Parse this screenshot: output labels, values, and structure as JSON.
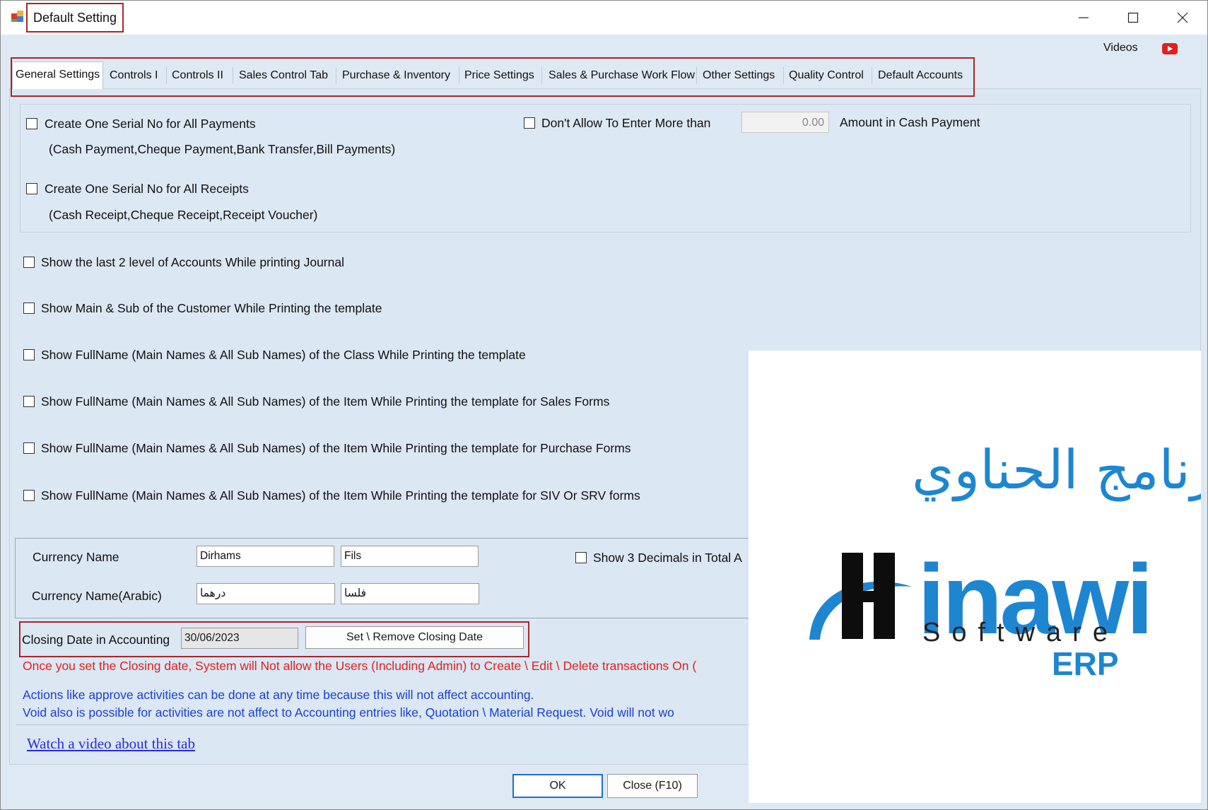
{
  "window": {
    "title": "Default Setting"
  },
  "header": {
    "videos_label": "Videos"
  },
  "tabs": [
    {
      "label": "General Settings"
    },
    {
      "label": "Controls I"
    },
    {
      "label": "Controls II"
    },
    {
      "label": "Sales Control Tab"
    },
    {
      "label": "Purchase & Inventory"
    },
    {
      "label": "Price Settings"
    },
    {
      "label": "Sales & Purchase Work Flow"
    },
    {
      "label": "Other Settings"
    },
    {
      "label": "Quality Control"
    },
    {
      "label": "Default Accounts"
    }
  ],
  "payments": {
    "serial_payments": "Create One Serial No for All Payments",
    "serial_payments_note": "(Cash Payment,Cheque Payment,Bank Transfer,Bill Payments)",
    "serial_receipts": "Create One Serial No for All Receipts",
    "serial_receipts_note": "(Cash Receipt,Cheque Receipt,Receipt Voucher)",
    "dont_allow_label": "Don't Allow To Enter More than",
    "amount_value": "0.00",
    "amount_suffix": "Amount in Cash Payment"
  },
  "options": [
    "Show the last 2 level of Accounts While printing Journal",
    "Show Main & Sub of the Customer While Printing the template",
    "Show FullName (Main Names & All Sub Names) of the Class While Printing the template",
    "Show FullName (Main Names & All Sub Names) of the Item While Printing the template for Sales Forms",
    "Show FullName (Main Names & All Sub Names) of the Item While Printing the template for Purchase Forms",
    "Show FullName (Main Names & All Sub Names) of the Item While Printing the template for SIV Or SRV forms"
  ],
  "currency": {
    "name_label": "Currency Name",
    "name_main": "Dirhams",
    "name_sub": "Fils",
    "arabic_label": "Currency Name(Arabic)",
    "arabic_main": "درهما",
    "arabic_sub": "فلسا",
    "decimals_label": "Show 3 Decimals in Total A"
  },
  "closing": {
    "label": "Closing Date in Accounting",
    "date": "30/06/2023",
    "button": "Set \\ Remove Closing Date",
    "warning": "Once you set the Closing date, System will Not allow the Users (Including Admin)  to Create \\ Edit \\ Delete transactions On (",
    "info1": "Actions like approve activities can be done at any time because this will not affect accounting.",
    "info2": "Void also is possible for activities are not affect to Accounting entries like, Quotation \\ Material Request. Void will not wo"
  },
  "link": "Watch a video about this tab",
  "footer": {
    "ok": "OK",
    "close": "Close (F10)"
  },
  "logo": {
    "arabic": "برنامج الحناوي",
    "main_tail": "inawi",
    "software": "Software",
    "erp": "ERP"
  },
  "colors": {
    "accent_red": "#a8262b",
    "brand_blue": "#1e86d0",
    "warning_red": "#e0201e",
    "info_blue": "#1a3fd6"
  }
}
